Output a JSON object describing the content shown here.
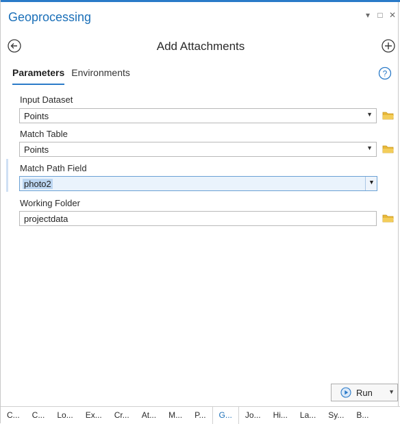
{
  "window": {
    "title": "Geoprocessing",
    "controls": [
      "▾",
      "□",
      "✕"
    ]
  },
  "tool": {
    "title": "Add Attachments"
  },
  "tabs": {
    "parameters": "Parameters",
    "environments": "Environments"
  },
  "fields": [
    {
      "label": "Input Dataset",
      "value": "Points",
      "type": "dropdown"
    },
    {
      "label": "Match Table",
      "value": "Points",
      "type": "dropdown"
    },
    {
      "label": "Match Path Field",
      "value": "photo2",
      "type": "dropdown",
      "focused": true
    },
    {
      "label": "Working Folder",
      "value": "projectdata",
      "type": "folder"
    }
  ],
  "run": {
    "label": "Run"
  },
  "bottom_tabs": [
    "C...",
    "C...",
    "Lo...",
    "Ex...",
    "Cr...",
    "At...",
    "M...",
    "P...",
    "G...",
    "Jo...",
    "Hi...",
    "La...",
    "Sy...",
    "B..."
  ],
  "bottom_tabs_active_index": 8,
  "colors": {
    "accent": "#2a7ac8",
    "title": "#1a6fb8",
    "folder": "#e8b83a",
    "focus": "#bcd6f1"
  },
  "icons": {
    "back": "back-arrow-circle-icon",
    "add": "plus-circle-icon",
    "help": "help-question-icon",
    "folder": "folder-icon",
    "run": "play-circle-icon"
  }
}
